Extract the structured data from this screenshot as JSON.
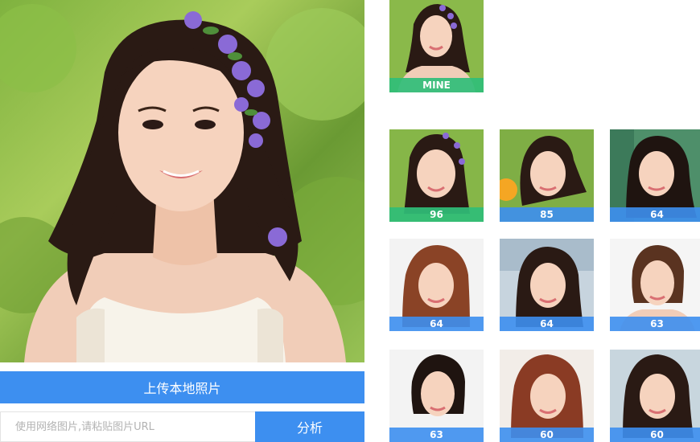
{
  "main_photo": {
    "description_icon": "portrait-photo-icon"
  },
  "upload": {
    "label": "上传本地照片"
  },
  "url_input": {
    "placeholder": "使用网络图片,请粘贴图片URL",
    "value": ""
  },
  "analyze": {
    "label": "分析"
  },
  "mine": {
    "label": "MINE"
  },
  "results": [
    {
      "score": "96"
    },
    {
      "score": "85"
    },
    {
      "score": "64"
    },
    {
      "score": "64"
    },
    {
      "score": "64"
    },
    {
      "score": "63"
    },
    {
      "score": "63"
    },
    {
      "score": "60"
    },
    {
      "score": "60"
    }
  ],
  "colors": {
    "accent": "#3d8ff0",
    "match_highlight": "#30be78",
    "background": "#ffffff"
  }
}
